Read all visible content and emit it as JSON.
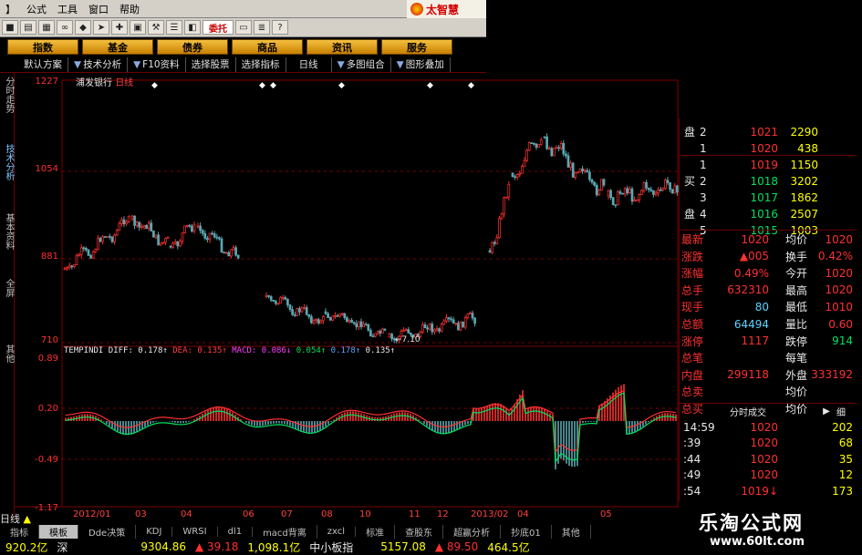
{
  "menu": {
    "items": [
      "】",
      "公式",
      "工具",
      "窗口",
      "帮助"
    ]
  },
  "logo": {
    "text": "太智慧",
    "order_btn": "委托"
  },
  "funcbar": {
    "buttons": [
      "指数",
      "基金",
      "债券",
      "商品",
      "资讯",
      "服务"
    ]
  },
  "tabs": [
    "默认方案",
    "技术分析",
    "F10资料",
    "选择股票",
    "选择指标",
    "日线",
    "多图组合",
    "图形叠加"
  ],
  "left_tabs": [
    "分时走势",
    "技术分析",
    "基本资料",
    "全屏",
    "其他"
  ],
  "stock": {
    "name": "浦发银行",
    "period": "日线"
  },
  "price_axis": [
    "1227",
    "1054",
    "881",
    "710"
  ],
  "low_mark": "7.10",
  "macd": {
    "label": "TEMPINDI",
    "diff": "DIFF: 0.178↑",
    "dea": "DEA: 0.135↑",
    "macd": "MACD: 0.086↓",
    "v4": "0.054↑",
    "v5": "0.178↑",
    "v6": "0.135↑",
    "axis": [
      "0.89",
      "0.20",
      "-0.49",
      "-1.17"
    ]
  },
  "date_axis": [
    "2012/01",
    "03",
    "04",
    "06",
    "07",
    "08",
    "10",
    "11",
    "12",
    "2013/02",
    "04",
    "05"
  ],
  "period_label": "日线",
  "orderbook": {
    "sell": [
      {
        "label": "盘",
        "level": "2",
        "price": "1021",
        "vol": "2290"
      },
      {
        "label": "",
        "level": "1",
        "price": "1020",
        "vol": "438"
      }
    ],
    "buy_label_1": "买",
    "buy_label_2": "盘",
    "buy": [
      {
        "level": "1",
        "price": "1019",
        "vol": "1150"
      },
      {
        "level": "2",
        "price": "1018",
        "vol": "3202"
      },
      {
        "level": "3",
        "price": "1017",
        "vol": "1862"
      },
      {
        "level": "4",
        "price": "1016",
        "vol": "2507"
      },
      {
        "level": "5",
        "price": "1015",
        "vol": "1003"
      }
    ]
  },
  "quote": [
    {
      "k1": "最新",
      "v1": "1020",
      "k2": "均价",
      "v2": "1020"
    },
    {
      "k1": "涨跌",
      "v1": "▲005",
      "k2": "换手",
      "v2": "0.42%"
    },
    {
      "k1": "涨幅",
      "v1": "0.49%",
      "k2": "今开",
      "v2": "1020"
    },
    {
      "k1": "总手",
      "v1": "632310",
      "k2": "最高",
      "v2": "1020"
    },
    {
      "k1": "现手",
      "v1": "80",
      "k2": "最低",
      "v2": "1010"
    },
    {
      "k1": "总额",
      "v1": "64494",
      "k2": "量比",
      "v2": "0.60"
    },
    {
      "k1": "涨停",
      "v1": "1117",
      "k2": "跌停",
      "v2": "914"
    },
    {
      "k1": "总笔",
      "v1": "",
      "k2": "每笔",
      "v2": ""
    },
    {
      "k1": "内盘",
      "v1": "299118",
      "k2": "外盘",
      "v2": "333192"
    },
    {
      "k1": "总卖",
      "v1": "",
      "k2": "均价",
      "v2": ""
    },
    {
      "k1": "总买",
      "v1": "",
      "k2": "均价",
      "v2": ""
    }
  ],
  "ticks": {
    "header": "分时成交",
    "header_btn": "细",
    "rows": [
      {
        "time": "14:59",
        "price": "1020",
        "vol": "202"
      },
      {
        "time": ":39",
        "price": "1020",
        "vol": "68"
      },
      {
        "time": ":44",
        "price": "1020",
        "vol": "35"
      },
      {
        "time": ":49",
        "price": "1020",
        "vol": "12"
      },
      {
        "time": ":54",
        "price": "1019↓",
        "vol": "173"
      }
    ]
  },
  "indicators": [
    "指标",
    "模板",
    "Dde决策",
    "KDJ",
    "WRSI",
    "dl1",
    "macd背离",
    "zxcl",
    "标准",
    "查股东",
    "超赢分析",
    "抄底01",
    "其他"
  ],
  "status": {
    "amt1": "920.2亿",
    "mkt": "深",
    "idx1": "9304.86",
    "chg1": "▲ 39.18",
    "amt2": "1,098.1亿",
    "board": "中小板指",
    "idx2": "5157.08",
    "chg2": "▲ 89.50",
    "amt3": "464.5亿"
  },
  "brand": {
    "title": "乐淘公式网",
    "url": "www.60lt.com"
  },
  "colors": {
    "up": "#ff3030",
    "down": "#00e060",
    "grid": "#7a0000",
    "diff": "#ff3030",
    "dea": "#00e060"
  }
}
